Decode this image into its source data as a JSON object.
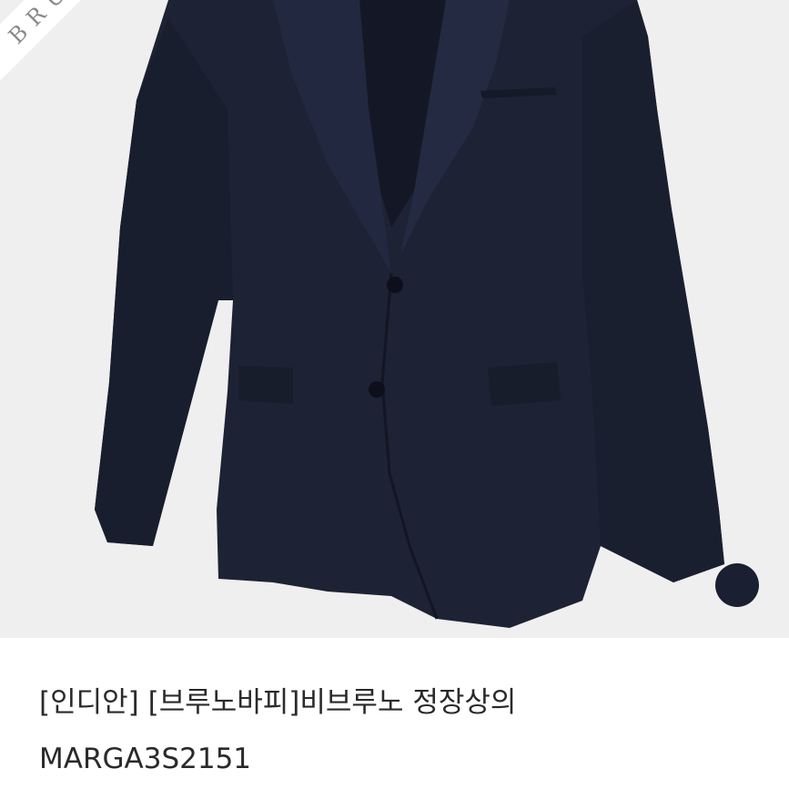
{
  "product": {
    "brand_mark": "BRU",
    "title": "[인디안] [브루노바피]비브루노 정장상의",
    "model": "MARGA3S2151",
    "colors": {
      "jacket": "#1d2234",
      "swatch": "#1a1f31",
      "image_bg": "#efefef"
    }
  }
}
